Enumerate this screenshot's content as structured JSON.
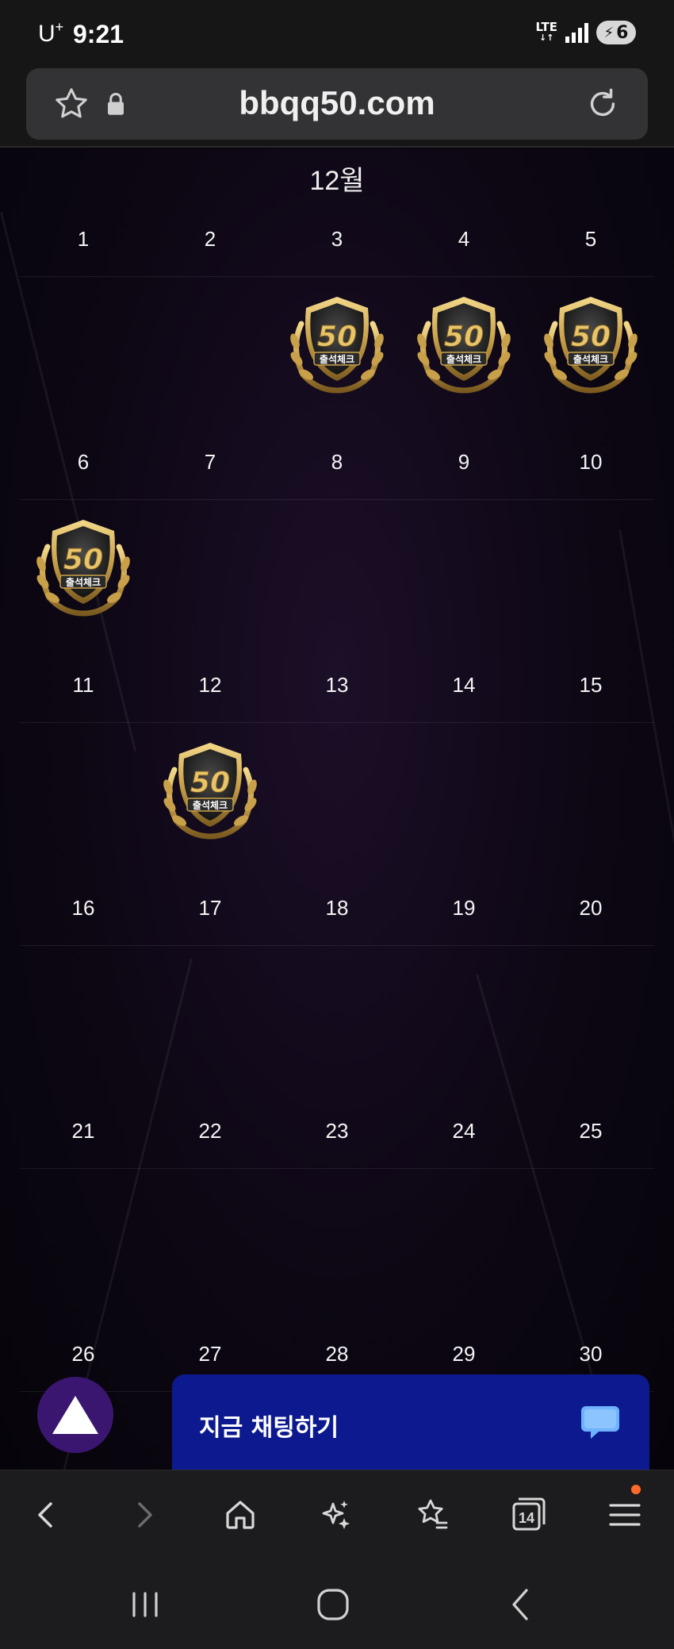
{
  "status_bar": {
    "carrier": "U",
    "carrier_sup": "+",
    "time": "9:21",
    "network": "LTE",
    "network_sub": "↓↑",
    "battery": "6"
  },
  "browser": {
    "url": "bbqq50.com",
    "tab_count": "14"
  },
  "calendar": {
    "month": "12월",
    "weeks": [
      [
        {
          "day": "1",
          "stamp": false
        },
        {
          "day": "2",
          "stamp": false
        },
        {
          "day": "3",
          "stamp": true
        },
        {
          "day": "4",
          "stamp": true
        },
        {
          "day": "5",
          "stamp": true
        }
      ],
      [
        {
          "day": "6",
          "stamp": true
        },
        {
          "day": "7",
          "stamp": false
        },
        {
          "day": "8",
          "stamp": false
        },
        {
          "day": "9",
          "stamp": false
        },
        {
          "day": "10",
          "stamp": false
        }
      ],
      [
        {
          "day": "11",
          "stamp": false
        },
        {
          "day": "12",
          "stamp": true
        },
        {
          "day": "13",
          "stamp": false
        },
        {
          "day": "14",
          "stamp": false
        },
        {
          "day": "15",
          "stamp": false
        }
      ],
      [
        {
          "day": "16",
          "stamp": false
        },
        {
          "day": "17",
          "stamp": false
        },
        {
          "day": "18",
          "stamp": false
        },
        {
          "day": "19",
          "stamp": false
        },
        {
          "day": "20",
          "stamp": false
        }
      ],
      [
        {
          "day": "21",
          "stamp": false
        },
        {
          "day": "22",
          "stamp": false
        },
        {
          "day": "23",
          "stamp": false
        },
        {
          "day": "24",
          "stamp": false
        },
        {
          "day": "25",
          "stamp": false
        }
      ],
      [
        {
          "day": "26",
          "stamp": false
        },
        {
          "day": "27",
          "stamp": false
        },
        {
          "day": "28",
          "stamp": false
        },
        {
          "day": "29",
          "stamp": false
        },
        {
          "day": "30",
          "stamp": false
        }
      ]
    ],
    "stamp_number": "50",
    "stamp_text": "출석체크"
  },
  "chat": {
    "label": "지금 채팅하기"
  },
  "icons": {
    "bookmark": "star-icon",
    "lock": "lock-icon",
    "reload": "reload-icon",
    "scroll_top": "triangle-up-icon",
    "chat": "chat-bubble-icon"
  },
  "colors": {
    "chat_banner": "#0d1a8f",
    "scroll_top": "#3b1670",
    "stamp_gold": "#c9a04a",
    "notification_dot": "#ff6a2b"
  }
}
